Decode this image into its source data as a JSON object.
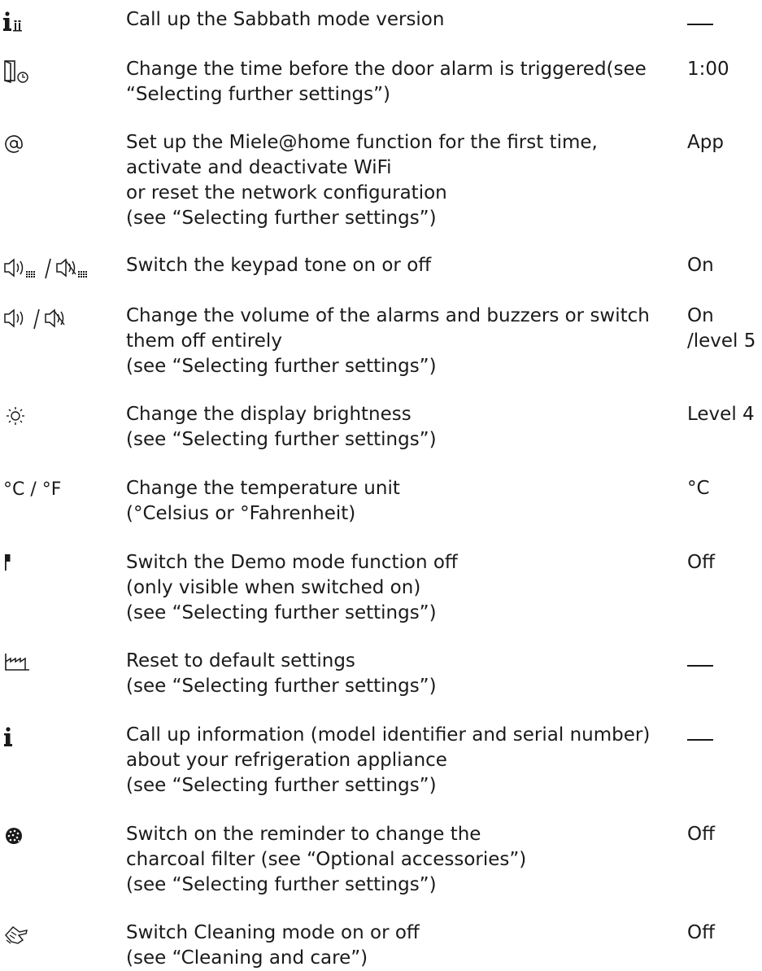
{
  "rows": [
    {
      "icon": "info-sabbath-icon",
      "lines": [
        "Call up the Sabbath mode version"
      ],
      "value": "—"
    },
    {
      "icon": "door-alarm-timer-icon",
      "lines": [
        "Change the time before the door alarm is triggered(see",
        "“Selecting further settings”)"
      ],
      "value": "1:00"
    },
    {
      "icon": "at-sign-icon",
      "lines": [
        "Set up the Miele@home function for the first time,",
        "activate and deactivate WiFi",
        "or reset the network configuration",
        "(see “Selecting further settings”)"
      ],
      "value": "App"
    },
    {
      "icon": "keypad-tone-icon",
      "lines": [
        "Switch the keypad tone on or off"
      ],
      "value": "On"
    },
    {
      "icon": "volume-icon",
      "lines": [
        "Change the volume of the alarms and buzzers or switch",
        "them off entirely",
        "(see “Selecting further settings”)"
      ],
      "value": [
        "On",
        "/level 5"
      ]
    },
    {
      "icon": "brightness-icon",
      "lines": [
        "Change the display brightness",
        "(see “Selecting further settings”)"
      ],
      "value": "Level 4"
    },
    {
      "icon": "temperature-unit-icon",
      "iconText": "°C / °F",
      "lines": [
        "Change the temperature unit",
        "(°Celsius or °Fahrenheit)"
      ],
      "value": "°C"
    },
    {
      "icon": "demo-mode-flag-icon",
      "lines": [
        "Switch the Demo mode function off",
        "(only visible when switched on)",
        "(see “Selecting further settings”)"
      ],
      "value": "Off"
    },
    {
      "icon": "factory-reset-icon",
      "lines": [
        "Reset to default settings",
        "(see “Selecting further settings”)"
      ],
      "value": "—"
    },
    {
      "icon": "info-icon",
      "lines": [
        "Call up information (model identifier and serial number)",
        "about your refrigeration appliance",
        "(see “Selecting further settings”)"
      ],
      "value": "—"
    },
    {
      "icon": "charcoal-filter-icon",
      "lines": [
        "Switch on the reminder to change the",
        "charcoal filter (see “Optional accessories”)",
        "(see “Selecting further settings”)"
      ],
      "value": "Off"
    },
    {
      "icon": "cleaning-mode-icon",
      "lines": [
        "Switch Cleaning mode on or off",
        "(see “Cleaning and care”)"
      ],
      "value": "Off"
    }
  ]
}
